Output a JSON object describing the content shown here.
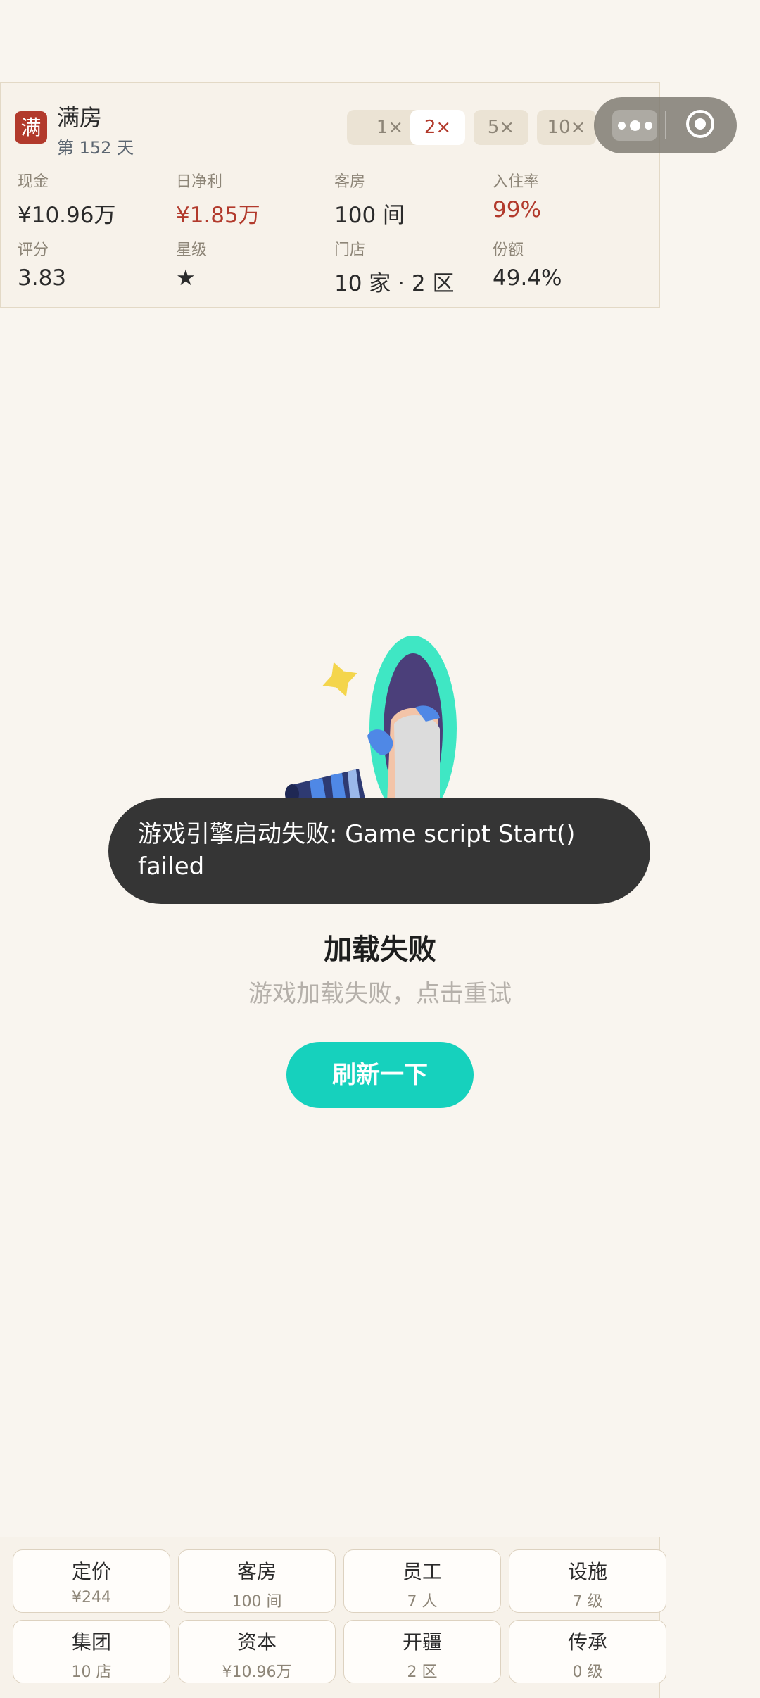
{
  "header": {
    "logo_char": "满",
    "app_title": "满房",
    "day_label": "第 152 天",
    "speed_options": [
      "1×",
      "2×",
      "5×",
      "10×"
    ],
    "active_speed": "2×",
    "stats": [
      {
        "label": "现金",
        "value": "¥10.96万"
      },
      {
        "label": "日净利",
        "value": "¥1.85万"
      },
      {
        "label": "客房",
        "value": "100 间"
      },
      {
        "label": "入住率",
        "value": "99%"
      },
      {
        "label": "评分",
        "value": "3.83"
      },
      {
        "label": "星级",
        "value": "★"
      },
      {
        "label": "门店",
        "value": "10 家 · 2 区"
      },
      {
        "label": "份额",
        "value": "49.4%"
      }
    ]
  },
  "capsule": {
    "more_icon": "more-dots-icon",
    "close_icon": "close-circle-icon"
  },
  "toast": {
    "message": "游戏引擎启动失败: Game script Start() failed"
  },
  "error": {
    "title": "加载失败",
    "subtitle": "游戏加载失败，点击重试",
    "retry_label": "刷新一下"
  },
  "actions": [
    {
      "title": "定价",
      "sub": "¥244"
    },
    {
      "title": "客房",
      "sub": "100 间"
    },
    {
      "title": "员工",
      "sub": "7 人"
    },
    {
      "title": "设施",
      "sub": "7 级"
    },
    {
      "title": "集团",
      "sub": "10 店"
    },
    {
      "title": "资本",
      "sub": "¥10.96万"
    },
    {
      "title": "开疆",
      "sub": "2 区"
    },
    {
      "title": "传承",
      "sub": "0 级"
    }
  ],
  "colors": {
    "accent_red": "#b23a2c",
    "retry_teal": "#16d1bd",
    "background": "#f9f5ef"
  }
}
